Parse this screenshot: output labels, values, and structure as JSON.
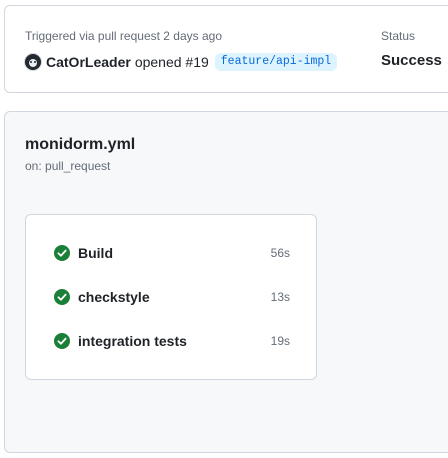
{
  "summary": {
    "trigger_text": "Triggered via pull request 2 days ago",
    "actor": "CatOrLeader",
    "action": "opened #19",
    "branch": "feature/api-impl",
    "status_label": "Status",
    "status_value": "Success"
  },
  "workflow": {
    "file": "monidorm.yml",
    "trigger": "on: pull_request",
    "jobs": [
      {
        "name": "Build",
        "duration": "56s",
        "status": "success",
        "icon": "check-circle-icon"
      },
      {
        "name": "checkstyle",
        "duration": "13s",
        "status": "success",
        "icon": "check-circle-icon"
      },
      {
        "name": "integration tests",
        "duration": "19s",
        "status": "success",
        "icon": "check-circle-icon"
      }
    ]
  },
  "colors": {
    "success": "#1a7f37",
    "link": "#0969da",
    "branch_bg": "#ddf4ff",
    "muted": "#636c76",
    "border": "#d0d7de",
    "panel_bg": "#f6f8fa"
  }
}
